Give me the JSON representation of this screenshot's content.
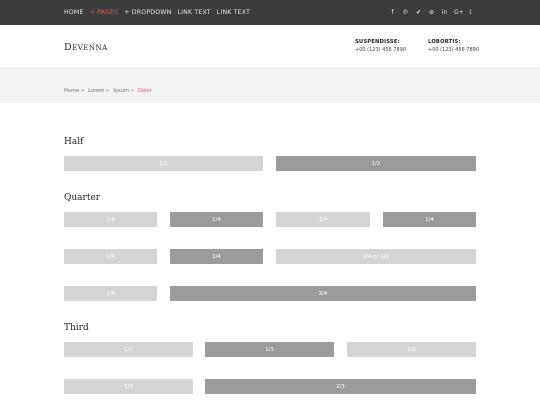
{
  "topbar": {
    "nav": [
      {
        "label": "HOME",
        "active": false
      },
      {
        "label": "+ PAGES",
        "active": true
      },
      {
        "label": "+ DROPDOWN",
        "active": false
      },
      {
        "label": "LINK TEXT",
        "active": false
      },
      {
        "label": "LINK TEXT",
        "active": false
      }
    ],
    "social": [
      {
        "icon": "facebook-icon",
        "glyph": "f"
      },
      {
        "icon": "pinterest-icon",
        "glyph": "℗"
      },
      {
        "icon": "twitter-icon",
        "glyph": "✔"
      },
      {
        "icon": "dribbble-icon",
        "glyph": "⊛"
      },
      {
        "icon": "linkedin-icon",
        "glyph": "in"
      },
      {
        "icon": "google-plus-icon",
        "glyph": "G+"
      },
      {
        "icon": "rss-icon",
        "glyph": "⟟"
      }
    ],
    "active_color": "#e4554a",
    "background": "#3c3c3c"
  },
  "header": {
    "logo": "Devenna",
    "contacts": [
      {
        "title": "SUSPENDISSE:",
        "phone": "+00 (123) 456 7890"
      },
      {
        "title": "LOBORTIS:",
        "phone": "+00 (123) 456 7890"
      }
    ]
  },
  "breadcrumb": {
    "items": [
      "Home »",
      "Lorem »",
      "Ipsum »"
    ],
    "current": "Dolor"
  },
  "sections": {
    "half": {
      "title": "Half",
      "rows": [
        [
          "1/2",
          "1/2"
        ]
      ]
    },
    "quarter": {
      "title": "Quarter",
      "rows": [
        [
          "1/4",
          "1/4",
          "1/4",
          "1/4"
        ],
        [
          "1/4",
          "1/4",
          "2/4 or 1/2"
        ],
        [
          "1/4",
          "3/4"
        ]
      ]
    },
    "third": {
      "title": "Third",
      "rows": [
        [
          "1/3",
          "1/3",
          "1/3"
        ],
        [
          "1/3",
          "2/3"
        ]
      ]
    }
  }
}
